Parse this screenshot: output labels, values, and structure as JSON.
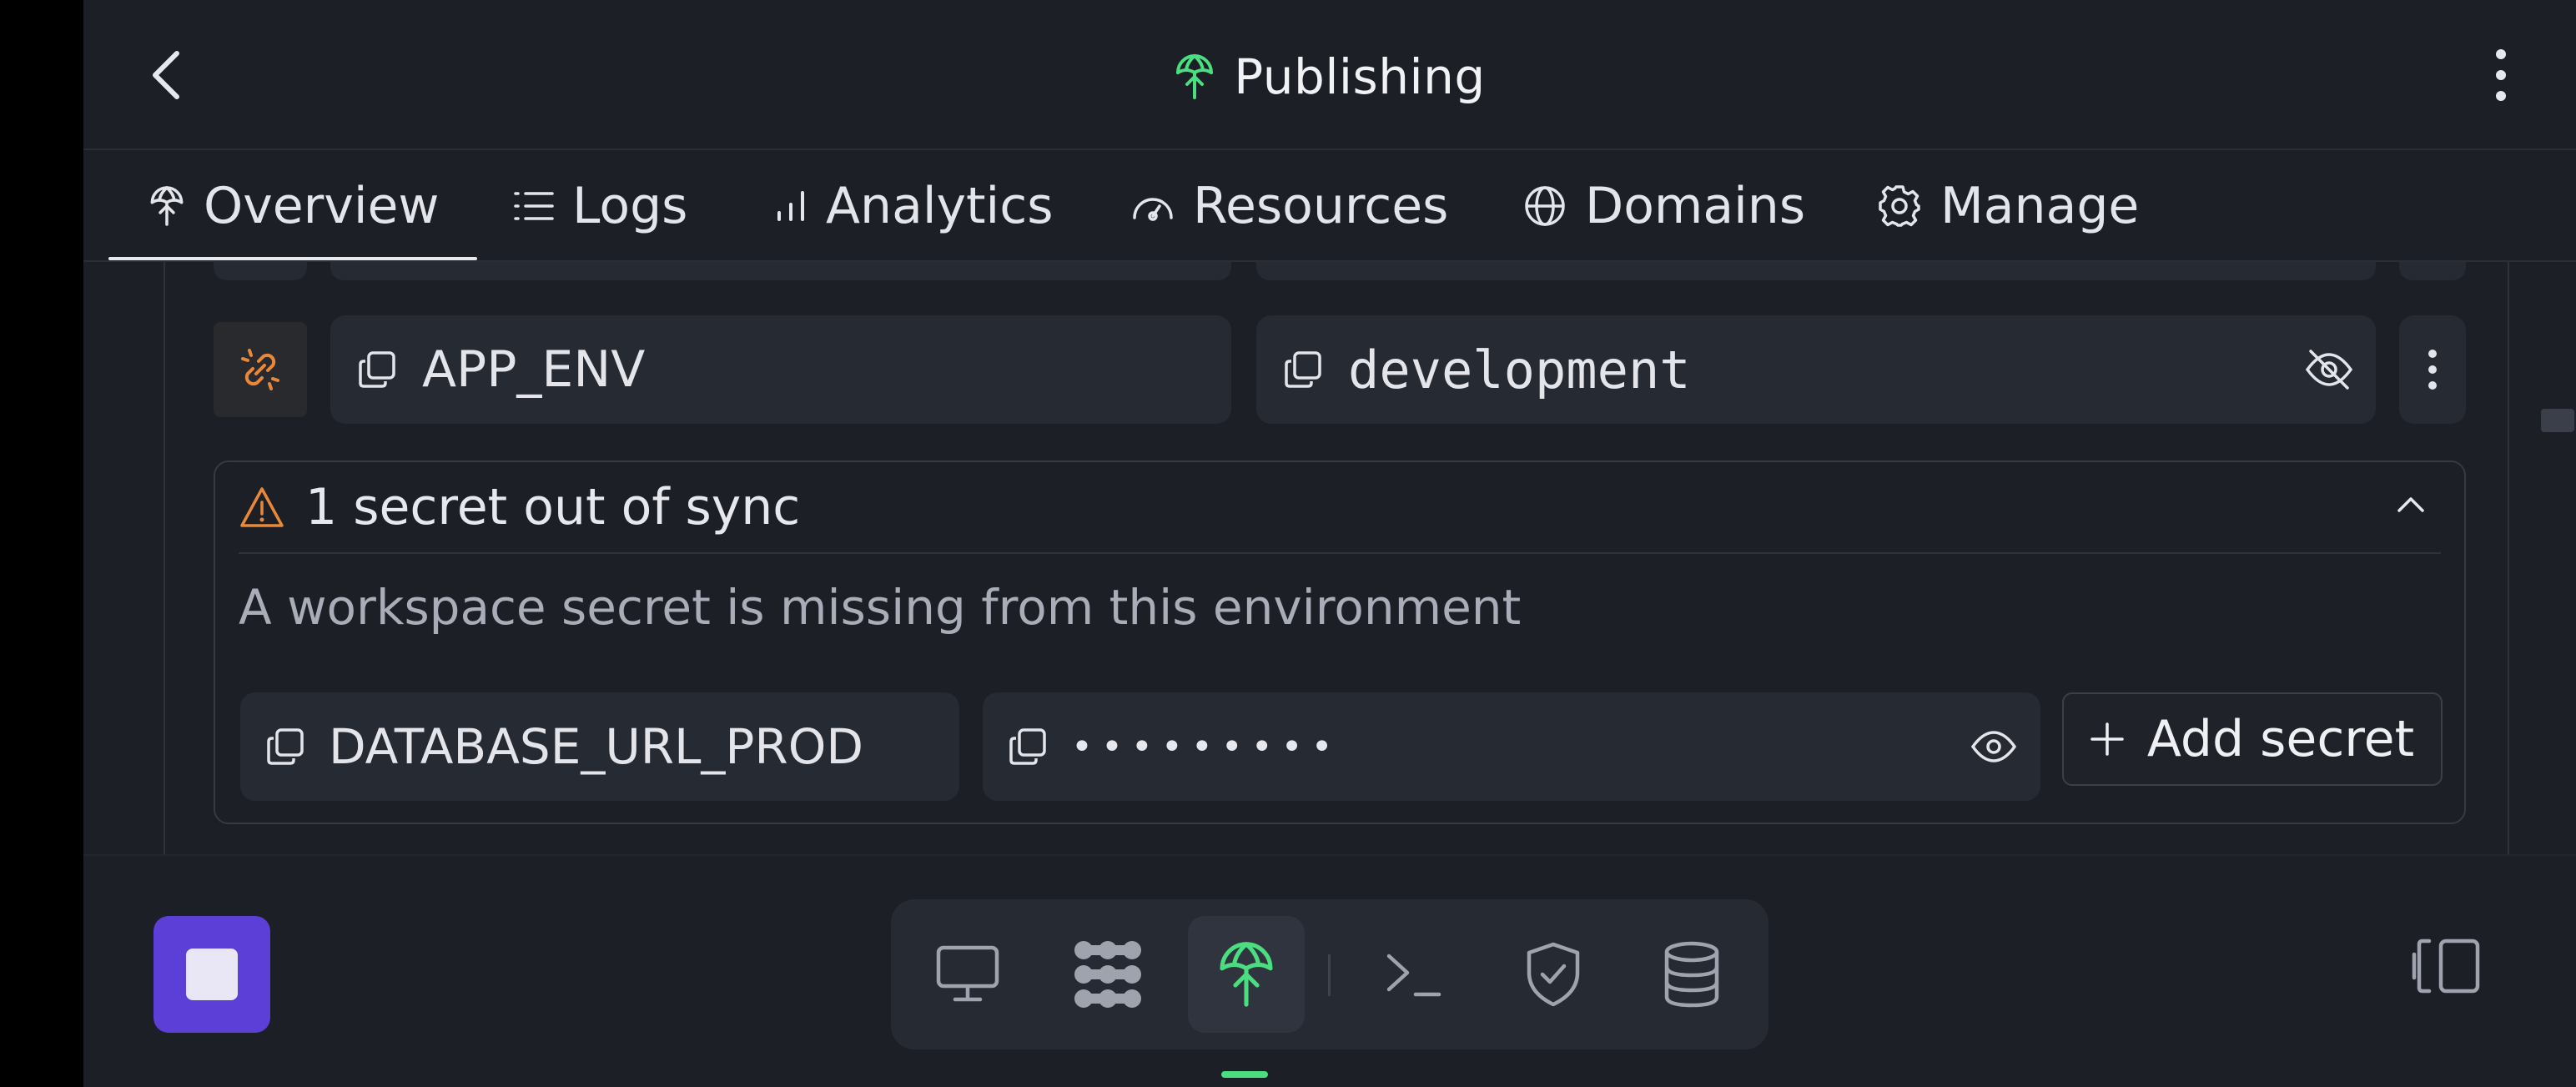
{
  "header": {
    "title": "Publishing"
  },
  "tabs": [
    {
      "label": "Overview",
      "icon": "publish-icon",
      "active": true
    },
    {
      "label": "Logs",
      "icon": "list-icon"
    },
    {
      "label": "Analytics",
      "icon": "bar-chart-icon"
    },
    {
      "label": "Resources",
      "icon": "gauge-icon"
    },
    {
      "label": "Domains",
      "icon": "globe-icon"
    },
    {
      "label": "Manage",
      "icon": "gear-icon"
    }
  ],
  "secret_row": {
    "key": "APP_ENV",
    "value": "development"
  },
  "sync_warning": {
    "title": "1 secret out of sync",
    "description": "A workspace secret is missing from this environment",
    "missing_key": "DATABASE_URL_PROD",
    "masked_value": "•••••••••",
    "add_button": "Add secret"
  },
  "colors": {
    "background": "#1c1f26",
    "accent_green": "#4ade80",
    "warning_orange": "#e8893a",
    "stop_button": "#5b3fd6"
  }
}
